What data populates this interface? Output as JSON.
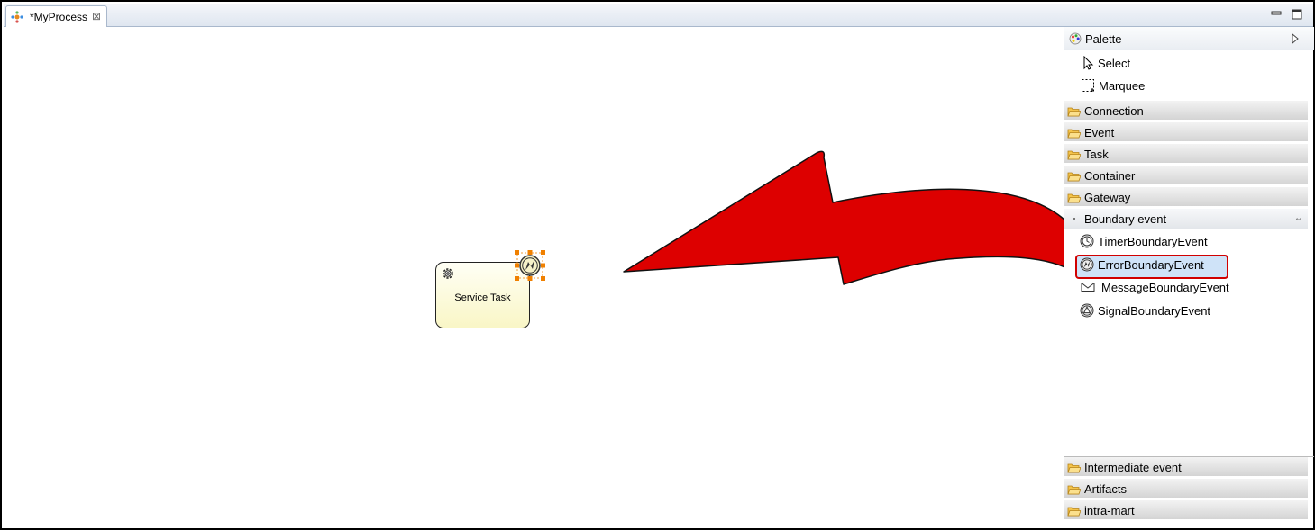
{
  "editor": {
    "tab_title": "*MyProcess",
    "tab_close_symbol": "⊠"
  },
  "canvas": {
    "task_label": "Service Task"
  },
  "palette": {
    "title": "Palette",
    "tools": [
      {
        "label": "Select",
        "icon": "pointer-icon"
      },
      {
        "label": "Marquee",
        "icon": "marquee-icon"
      }
    ],
    "drawers_top": [
      {
        "label": "Connection"
      },
      {
        "label": "Event"
      },
      {
        "label": "Task"
      },
      {
        "label": "Container"
      },
      {
        "label": "Gateway"
      }
    ],
    "open_drawer": {
      "label": "Boundary event",
      "resize_symbol": "↔",
      "items": [
        {
          "label": "TimerBoundaryEvent",
          "icon": "timer-boundary-icon"
        },
        {
          "label": "ErrorBoundaryEvent",
          "icon": "error-boundary-icon",
          "selected": true
        },
        {
          "label": "MessageBoundaryEvent",
          "icon": "message-boundary-icon"
        },
        {
          "label": "SignalBoundaryEvent",
          "icon": "signal-boundary-icon"
        }
      ]
    },
    "drawers_bottom": [
      {
        "label": "Intermediate event"
      },
      {
        "label": "Artifacts"
      },
      {
        "label": "intra-mart"
      }
    ]
  },
  "colors": {
    "arrow": "#dd0000",
    "highlight_border": "#d10000",
    "selection_handle": "#f08000",
    "task_fill": "#f9f6c6"
  }
}
